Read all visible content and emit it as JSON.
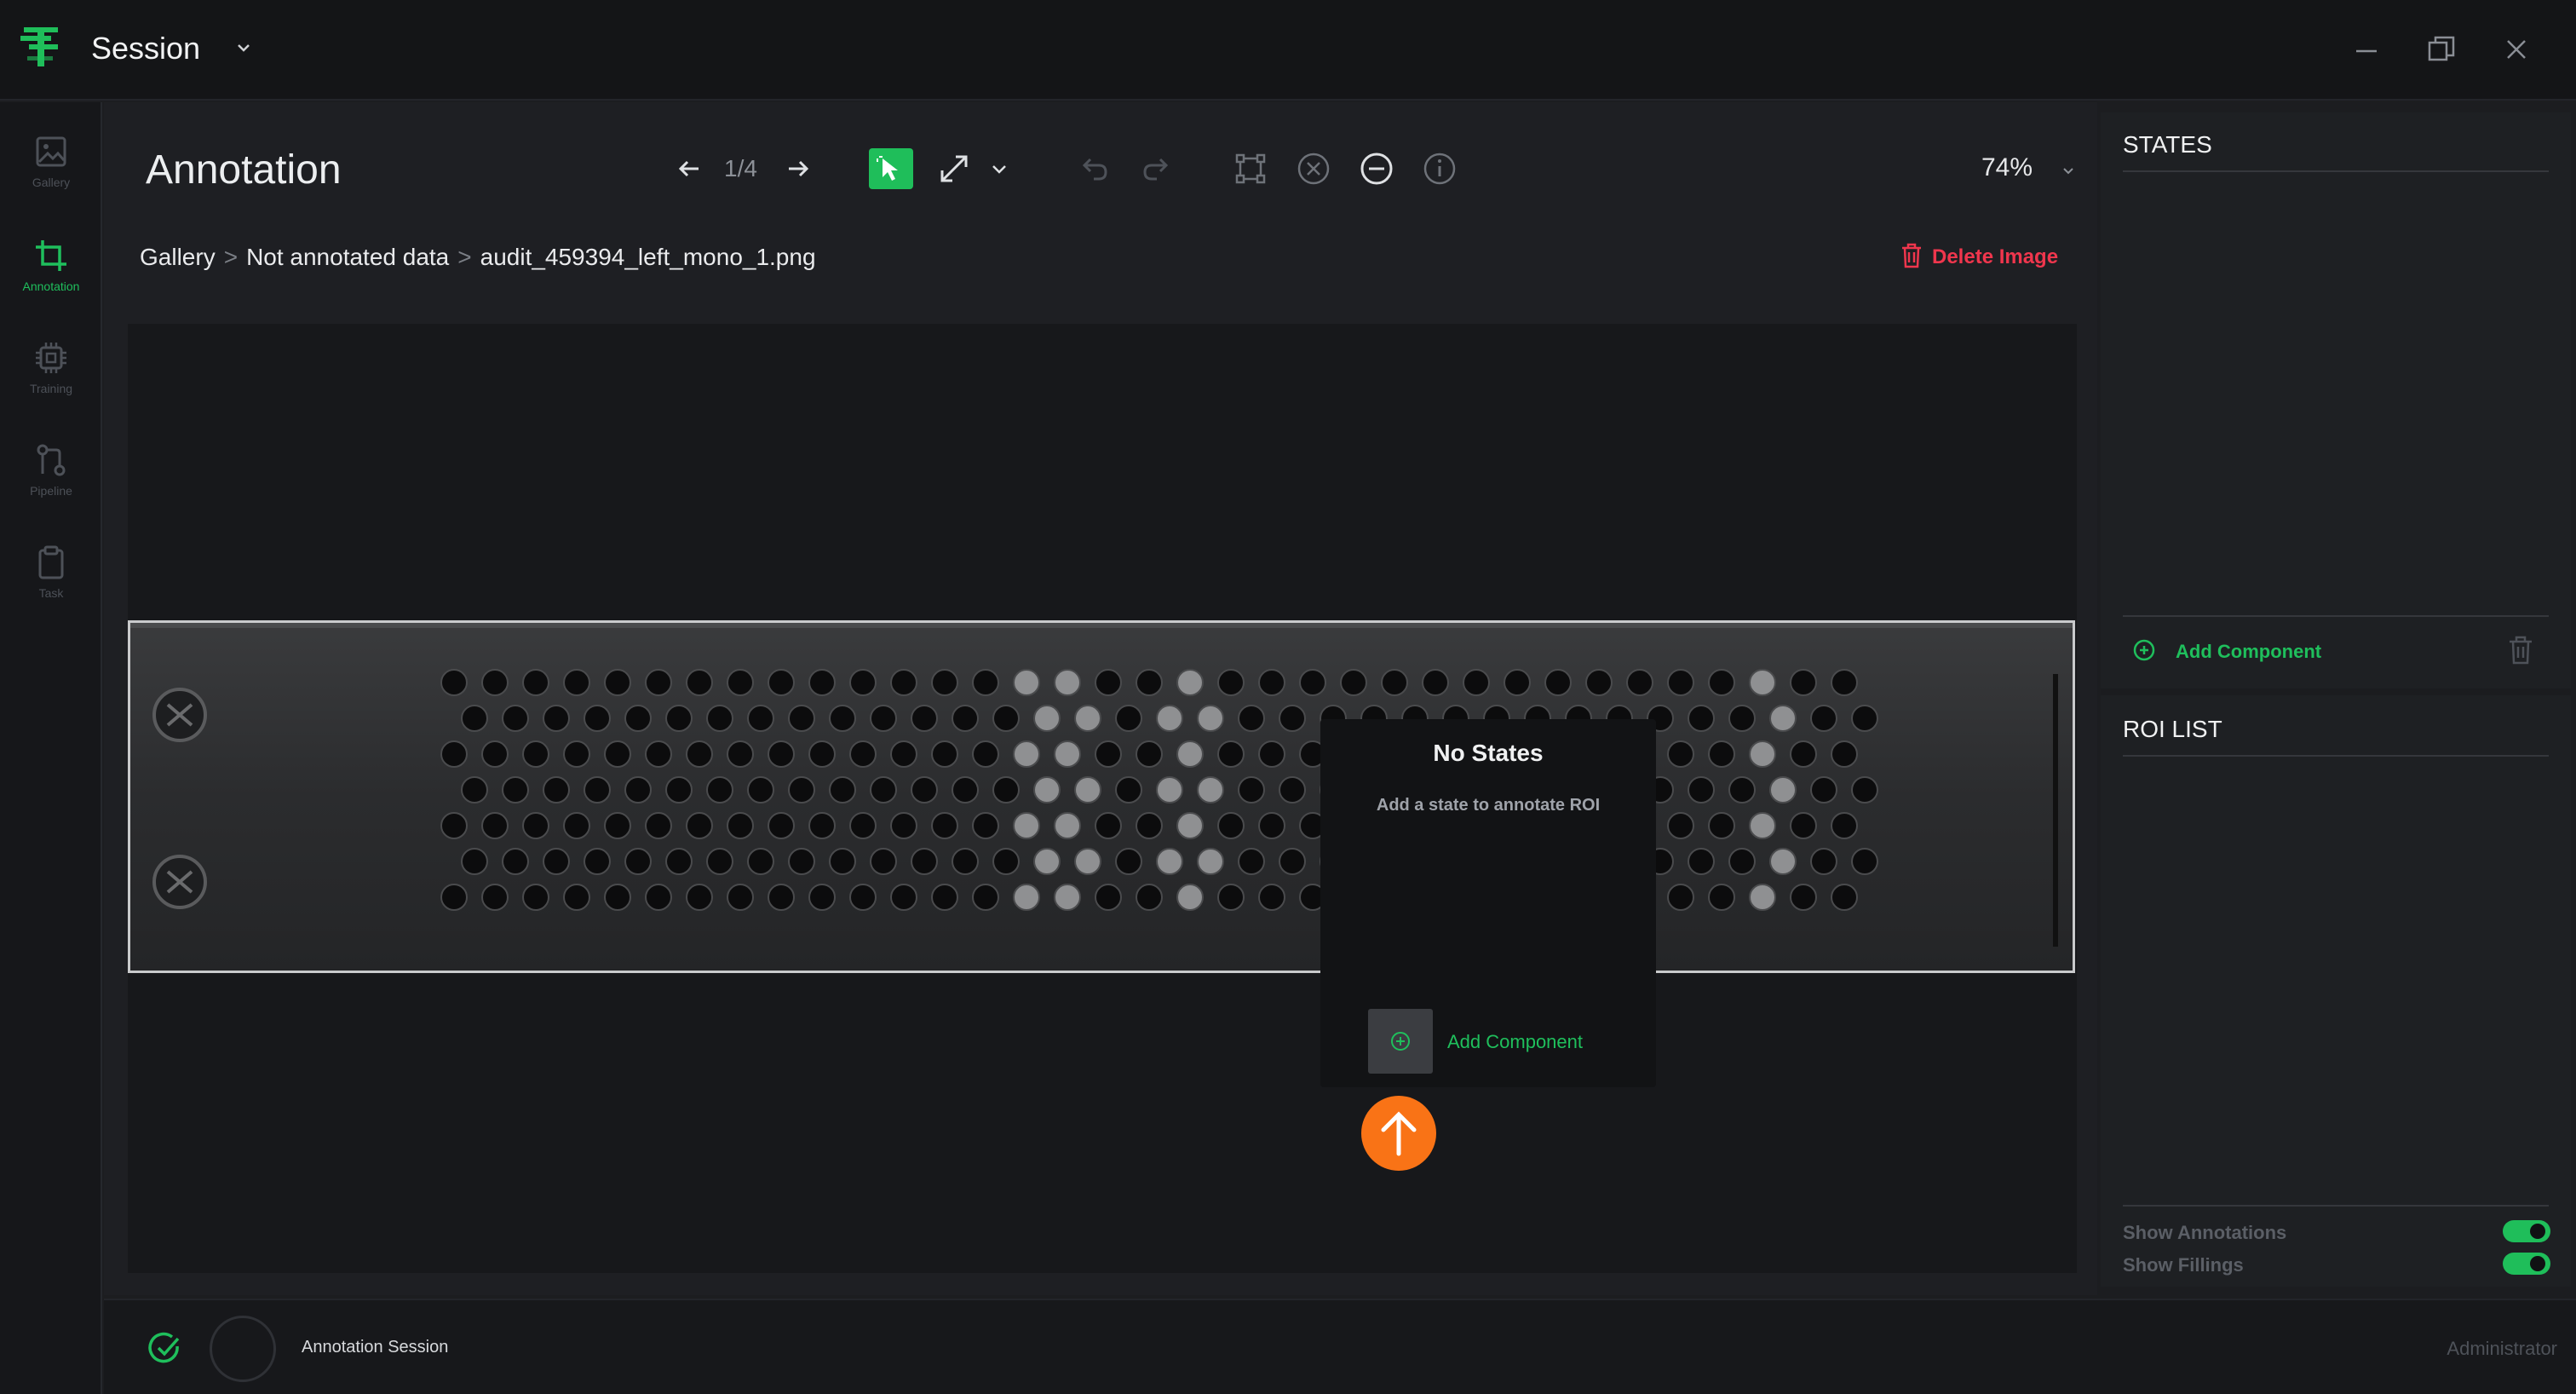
{
  "app": {
    "title": "Session"
  },
  "nav": {
    "items": [
      {
        "label": "Gallery",
        "icon": "image-icon",
        "active": false
      },
      {
        "label": "Annotation",
        "icon": "crop-icon",
        "active": true
      },
      {
        "label": "Training",
        "icon": "chip-icon",
        "active": false
      },
      {
        "label": "Pipeline",
        "icon": "pipeline-icon",
        "active": false
      },
      {
        "label": "Task",
        "icon": "clipboard-icon",
        "active": false
      }
    ]
  },
  "main": {
    "title": "Annotation",
    "page_counter": "1/4",
    "zoom": "74%",
    "breadcrumb": [
      "Gallery",
      "Not annotated data",
      "audit_459394_left_mono_1.png"
    ],
    "breadcrumb_separator": ">",
    "delete_label": "Delete Image"
  },
  "popover": {
    "title": "No States",
    "subtitle": "Add a state to annotate ROI",
    "add_label": "Add Component"
  },
  "states": {
    "title": "STATES",
    "add_label": "Add Component"
  },
  "roi": {
    "title": "ROI LIST",
    "toggles": [
      {
        "label": "Show Annotations",
        "on": true
      },
      {
        "label": "Show Fillings",
        "on": true
      }
    ]
  },
  "status": {
    "session_label": "Annotation Session",
    "user": "Administrator"
  },
  "colors": {
    "accent": "#1fbe5a",
    "danger": "#f0364d",
    "marker": "#f97316"
  }
}
